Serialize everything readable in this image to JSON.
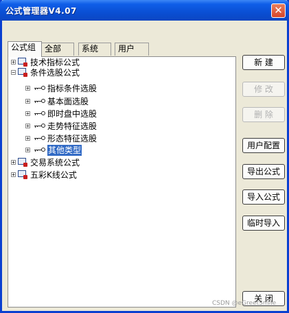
{
  "window": {
    "title": "公式管理器V4.07",
    "close_glyph": "✕"
  },
  "tabs": [
    {
      "label": "公式组",
      "active": true
    },
    {
      "label": "全部",
      "active": false
    },
    {
      "label": "系统",
      "active": false
    },
    {
      "label": "用户",
      "active": false
    }
  ],
  "tree": {
    "items": [
      {
        "label": "技术指标公式",
        "expander": "+",
        "icon": "formula-book-icon",
        "level": 0
      },
      {
        "label": "条件选股公式",
        "expander": "−",
        "icon": "formula-book-icon",
        "level": 0
      },
      {
        "label": "指标条件选股",
        "expander": "+",
        "icon": "key-icon",
        "level": 1
      },
      {
        "label": "基本面选股",
        "expander": "+",
        "icon": "key-icon",
        "level": 1
      },
      {
        "label": "即时盘中选股",
        "expander": "+",
        "icon": "key-icon",
        "level": 1
      },
      {
        "label": "走势特征选股",
        "expander": "+",
        "icon": "key-icon",
        "level": 1
      },
      {
        "label": "形态特征选股",
        "expander": "+",
        "icon": "key-icon",
        "level": 1
      },
      {
        "label": "其他类型",
        "expander": "+",
        "icon": "key-icon",
        "level": 1,
        "selected": true
      },
      {
        "label": "交易系统公式",
        "expander": "+",
        "icon": "formula-book-icon",
        "level": 0
      },
      {
        "label": "五彩K线公式",
        "expander": "+",
        "icon": "formula-book-icon",
        "level": 0
      }
    ]
  },
  "buttons": {
    "new": "新  建",
    "edit": "修  改",
    "delete": "删  除",
    "user_config": "用户配置",
    "export": "导出公式",
    "import": "导入公式",
    "temp_import": "临时导入",
    "close": "关  闭"
  },
  "watermark": "CSDN @eGreetSmile",
  "colors": {
    "selection": "#316ac5",
    "titlebar": "#0a4fd4",
    "close_button": "#d6452a"
  }
}
